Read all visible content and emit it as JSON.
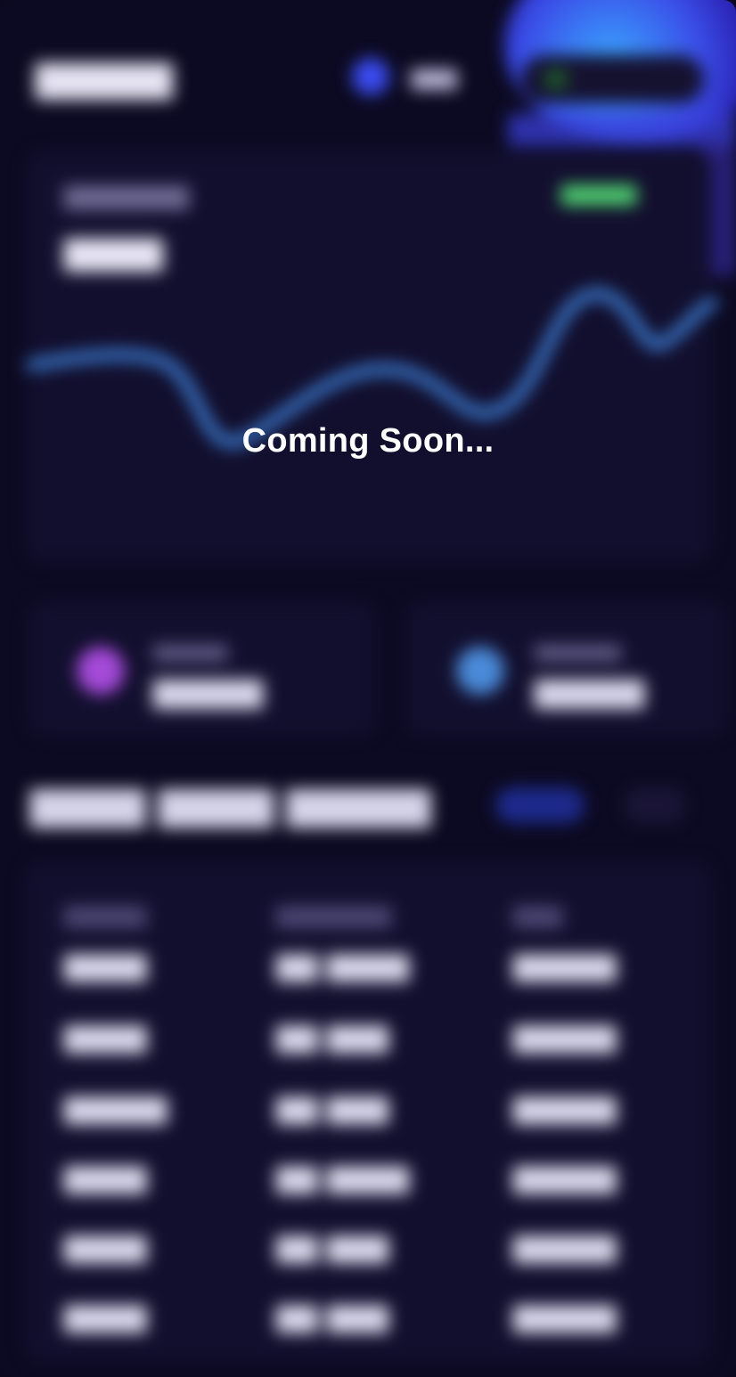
{
  "overlay": {
    "message": "Coming Soon..."
  },
  "colors": {
    "background": "#0c0a22",
    "card": "#120f2e",
    "accent_blue": "#3a4cf0",
    "chart_line": "#3d7fd6",
    "positive_green": "#4fd070",
    "dot_purple": "#a44ad8",
    "dot_blue": "#4a8ad8"
  }
}
